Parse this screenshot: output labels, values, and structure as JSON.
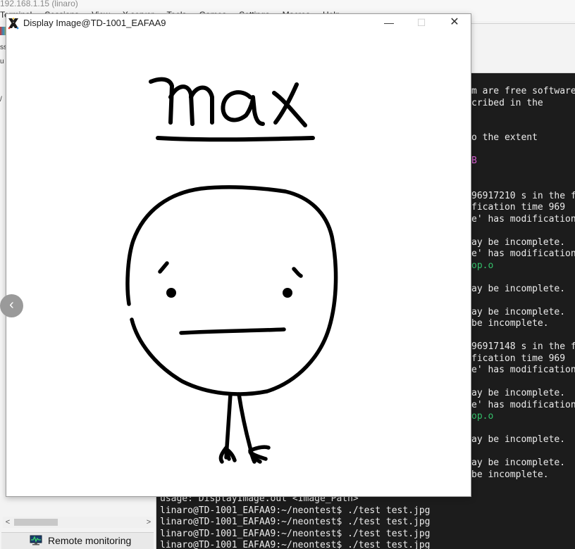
{
  "host": {
    "title": "192.168.1.15 (linaro)",
    "menu": [
      "Terminal",
      "Sessions",
      "View",
      "X server",
      "Tools",
      "Games",
      "Settings",
      "Macros",
      "Help"
    ],
    "left_labels": [
      "ss",
      "u",
      "/"
    ]
  },
  "sidebar": {
    "remote_monitoring_label": "Remote monitoring",
    "scroll_left": "<",
    "scroll_right": ">"
  },
  "terminal": {
    "lines_partial": [
      {
        "text": "m are free software",
        "color": "#ececec"
      },
      {
        "text": "cribed in the",
        "color": "#ececec"
      },
      {
        "text": "",
        "color": "#ececec"
      },
      {
        "text": "",
        "color": "#ececec"
      },
      {
        "text": "o the extent",
        "color": "#ececec"
      },
      {
        "text": "",
        "color": "#ececec"
      },
      {
        "text": "B",
        "color": "#d65fd0"
      },
      {
        "text": "",
        "color": "#ececec"
      },
      {
        "text": "",
        "color": "#ececec"
      },
      {
        "text": "96917210 s in the f",
        "color": "#ececec"
      },
      {
        "text": "fication time 969",
        "color": "#ececec"
      },
      {
        "text": "e' has modification",
        "color": "#ececec"
      },
      {
        "text": "",
        "color": "#ececec"
      },
      {
        "text": "ay be incomplete.",
        "color": "#ececec"
      },
      {
        "text": "e' has modification",
        "color": "#ececec"
      },
      {
        "text": "op.o",
        "color": "#34c06a"
      },
      {
        "text": "",
        "color": "#ececec"
      },
      {
        "text": "ay be incomplete.",
        "color": "#ececec"
      },
      {
        "text": "",
        "color": "#ececec"
      },
      {
        "text": "ay be incomplete.",
        "color": "#ececec"
      },
      {
        "text": "be incomplete.",
        "color": "#ececec"
      },
      {
        "text": "",
        "color": "#ececec"
      },
      {
        "text": "96917148 s in the f",
        "color": "#ececec"
      },
      {
        "text": "fication time 969",
        "color": "#ececec"
      },
      {
        "text": "e' has modification",
        "color": "#ececec"
      },
      {
        "text": "",
        "color": "#ececec"
      },
      {
        "text": "ay be incomplete.",
        "color": "#ececec"
      },
      {
        "text": "e' has modification",
        "color": "#ececec"
      },
      {
        "text": "op.o",
        "color": "#34c06a"
      },
      {
        "text": "",
        "color": "#ececec"
      },
      {
        "text": "ay be incomplete.",
        "color": "#ececec"
      },
      {
        "text": "",
        "color": "#ececec"
      },
      {
        "text": "ay be incomplete.",
        "color": "#ececec"
      },
      {
        "text": "be incomplete.",
        "color": "#ececec"
      }
    ],
    "lines_full": [
      "usage: DisplayImage.out <Image_Path>",
      "linaro@TD-1001_EAFAA9:~/neontest$ ./test test.jpg",
      "linaro@TD-1001_EAFAA9:~/neontest$ ./test test.jpg",
      "linaro@TD-1001_EAFAA9:~/neontest$ ./test test.jpg",
      "linaro@TD-1001_EAFAA9:~/neontest$ ./test test.jpg"
    ]
  },
  "display_window": {
    "title": "Display Image@TD-1001_EAFAA9",
    "minimize": "—",
    "maximize": "☐",
    "close": "✕",
    "drawing_text": "max"
  },
  "nav": {
    "back_glyph": "‹"
  },
  "colors": {
    "terminal_bg": "#1c1c1c",
    "terminal_fg": "#ececec",
    "terminal_green": "#34c06a",
    "terminal_magenta": "#d65fd0"
  }
}
